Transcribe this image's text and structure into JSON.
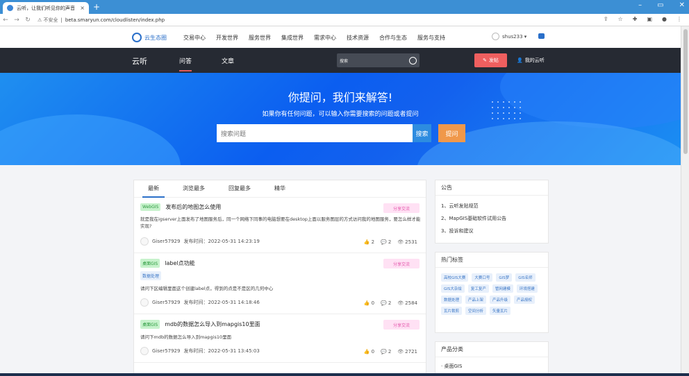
{
  "browser": {
    "tab_title": "云听，让我们听见你的声音",
    "tab_close": "×",
    "new_tab": "+",
    "insecure": "⚠ 不安全",
    "url": "beta.smaryun.com/cloudlisten/index.php",
    "win_min": "–",
    "win_max": "▭",
    "win_close": "✕"
  },
  "topnav": {
    "logo": "云生态圈",
    "menu": [
      "交易中心",
      "开发世界",
      "服务世界",
      "集成世界",
      "需求中心",
      "技术资源",
      "合作与生态",
      "服务与支持"
    ],
    "user": "shus233 ▾"
  },
  "darkbar": {
    "brand": "云听",
    "nav": [
      "问答",
      "文章"
    ],
    "search_placeholder": "搜索",
    "post_button": "发帖",
    "my_cloud": "我的云听"
  },
  "hero": {
    "title": "你提问，我们来解答!",
    "subtitle": "如果你有任何问题，可以输入你需要搜索的问题或者提问",
    "search_placeholder": "搜索问题",
    "search_button": "搜索",
    "ask_button": "提问"
  },
  "feed": {
    "tabs": [
      "最新",
      "浏览最多",
      "回复最多",
      "精华"
    ],
    "posts": [
      {
        "category": "WebGIS",
        "title": "发布后的地图怎么使用",
        "badge": "分享交流",
        "desc": "就是我在igserver上面发布了地图服务后，同一个网络下同事的电脑想要在desktop上面以服务图层的方式访问我的地图服务，要怎么样才能实现?",
        "author": "Giser57929",
        "time": "发布时间：2022-05-31 14:23:19",
        "likes": "2",
        "comments": "2",
        "views": "2531"
      },
      {
        "category": "桌面GIS",
        "title": "label点功能",
        "badge": "分享交流",
        "tag": "数据处理",
        "desc": "请问下区编辑里面这个创建label点，得到的点是不是区的几何中心",
        "author": "Giser57929",
        "time": "发布时间：2022-05-31 14:18:46",
        "likes": "0",
        "comments": "2",
        "views": "2584"
      },
      {
        "category": "桌面GIS",
        "title": "mdb的数据怎么导入到mapgis10里面",
        "badge": "分享交流",
        "desc": "请问下mdb的数据怎么导入到mapgis10里面",
        "author": "Giser57929",
        "time": "发布时间：2022-05-31 13:45:03",
        "likes": "0",
        "comments": "2",
        "views": "2721"
      }
    ]
  },
  "notice": {
    "title": "公告",
    "items": [
      "1、云听发贴规范",
      "2、MapGIS基础软件试用公告",
      "3、投诉和建议"
    ]
  },
  "hot_tags": {
    "title": "热门标签",
    "items": [
      "高校GIS大赛",
      "大赛口号",
      "GIS梦",
      "GIS名师",
      "GIS大杂烩",
      "复工复产",
      "管网建模",
      "环境搭建",
      "数据处理",
      "产品上架",
      "产品升级",
      "产品授权",
      "瓦片裁剪",
      "空间分析",
      "矢量瓦片"
    ]
  },
  "product": {
    "title": "产品分类",
    "first": "· 桌面GIS"
  },
  "colors": {
    "accent": "#2a6fc9",
    "dark_bar": "#262a33",
    "post_red": "#ef5f5f",
    "ask_orange": "#f0984a"
  }
}
